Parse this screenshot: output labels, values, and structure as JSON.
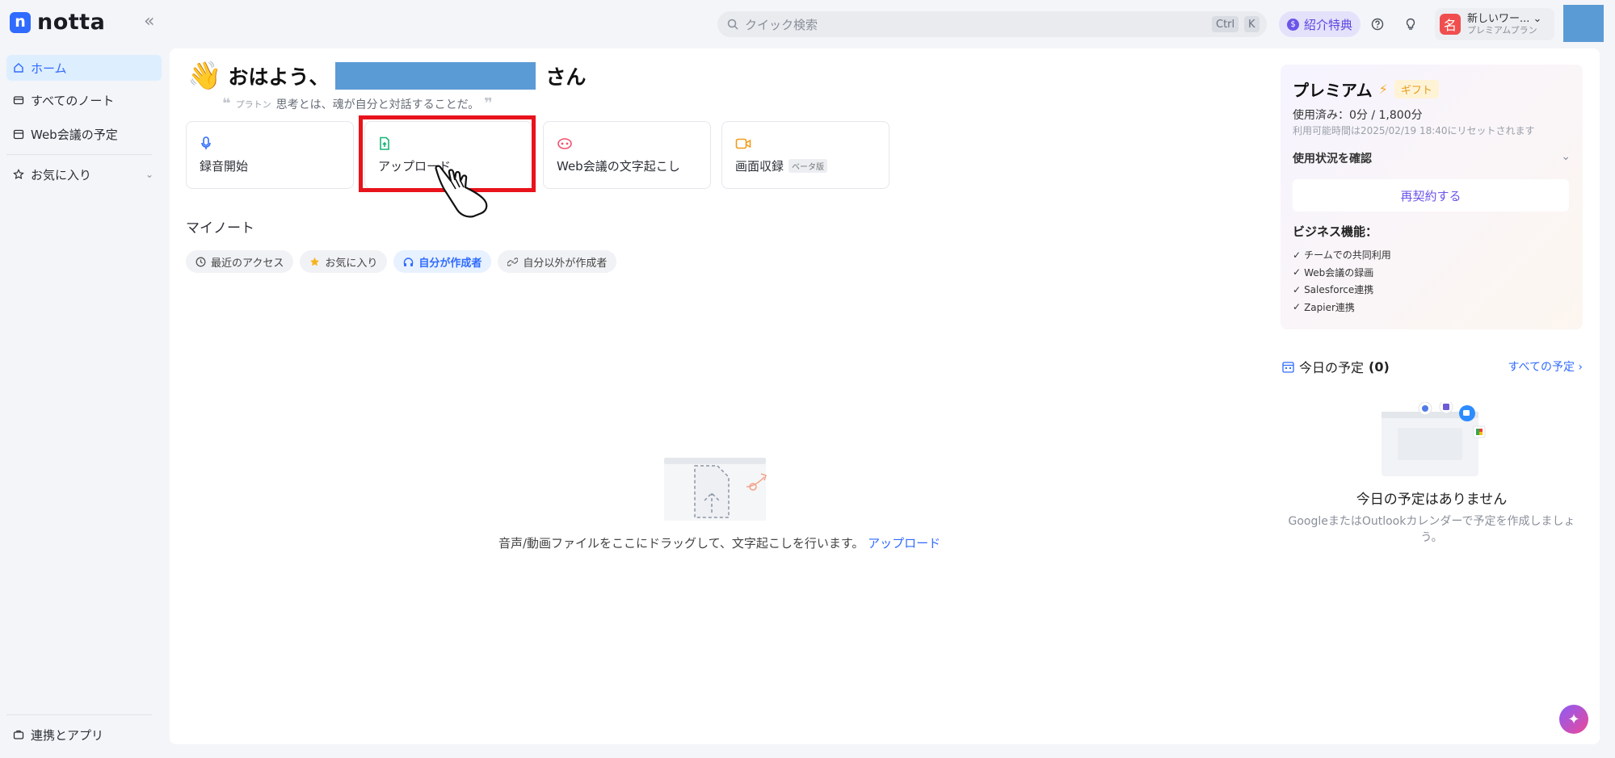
{
  "app": {
    "logo_mark": "n",
    "logo_text": "notta",
    "collapse_glyph": "«"
  },
  "topbar": {
    "search_placeholder": "クイック検索",
    "shortcut_ctrl": "Ctrl",
    "shortcut_key": "K",
    "referral_label": "紹介特典",
    "referral_coin": "$",
    "help_icon": "question-circle-icon",
    "tips_icon": "lightbulb-icon",
    "workspace_badge": "名",
    "workspace_name": "新しいワー...",
    "workspace_plan": "プレミアムプラン"
  },
  "sidebar": {
    "items": [
      {
        "label": "ホーム",
        "icon": "home-icon",
        "active": true
      },
      {
        "label": "すべてのノート",
        "icon": "folder-icon",
        "active": false
      },
      {
        "label": "Web会議の予定",
        "icon": "calendar-icon",
        "active": false
      },
      {
        "label": "お気に入り",
        "icon": "star-icon",
        "active": false
      }
    ],
    "bottom_item": {
      "label": "連携とアプリ",
      "icon": "briefcase-icon"
    }
  },
  "main": {
    "greeting_prefix": "おはよう、",
    "greeting_suffix": "さん",
    "quote_author": "プラトン",
    "quote_text": "思考とは、魂が自分と対話することだ。",
    "cards": [
      {
        "label": "録音開始",
        "icon": "microphone-icon",
        "color": "#2f6bff"
      },
      {
        "label": "アップロード",
        "icon": "upload-file-icon",
        "color": "#19b37a"
      },
      {
        "label": "Web会議の文字起こし",
        "icon": "meeting-bot-icon",
        "color": "#f0506e"
      },
      {
        "label": "画面収録",
        "icon": "video-camera-icon",
        "color": "#f29b1d",
        "badge": "ベータ版"
      }
    ],
    "section_title": "マイノート",
    "chips": [
      {
        "label": "最近のアクセス",
        "icon": "clock-icon",
        "active": false
      },
      {
        "label": "お気に入り",
        "icon": "star-filled-icon",
        "active": false
      },
      {
        "label": "自分が作成者",
        "icon": "headphones-icon",
        "active": true
      },
      {
        "label": "自分以外が作成者",
        "icon": "link-icon",
        "active": false
      }
    ],
    "empty_text": "音声/動画ファイルをここにドラッグして、文字起こしを行います。",
    "empty_link": "アップロード"
  },
  "premium": {
    "title": "プレミアム",
    "gift": "ギフト",
    "used": "使用済み：0分 / 1,800分",
    "reset": "利用可能時間は2025/02/19 18:40にリセットされます",
    "usage_toggle": "使用状況を確認",
    "renew": "再契約する",
    "biz_title": "ビジネス機能：",
    "biz_features": [
      "チームでの共同利用",
      "Web会議の録画",
      "Salesforce連携",
      "Zapier連携"
    ]
  },
  "schedule": {
    "title": "今日の予定",
    "count": "(0)",
    "all_link": "すべての予定 ›",
    "empty_title": "今日の予定はありません",
    "empty_sub": "GoogleまたはOutlookカレンダーで予定を作成しましょう。"
  },
  "colors": {
    "accent": "#2f6bff",
    "highlight": "#e8131b",
    "redaction": "#5b9bd5"
  }
}
